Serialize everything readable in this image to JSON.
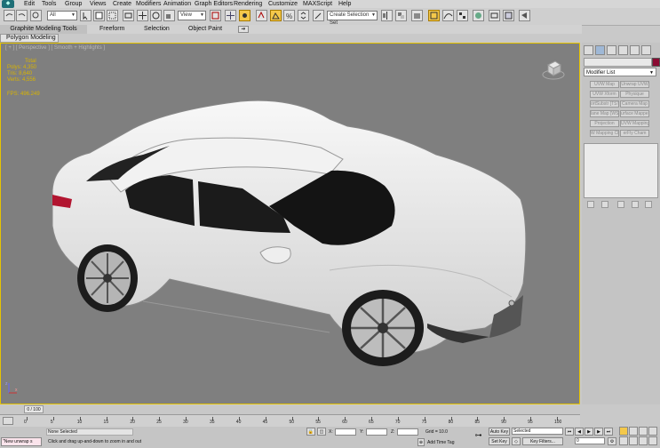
{
  "menubar": {
    "items": [
      "Edit",
      "Tools",
      "Group",
      "Views",
      "Create",
      "Modifiers",
      "Animation",
      "Graph Editors",
      "Rendering",
      "Customize",
      "MAXScript",
      "Help"
    ]
  },
  "toolbar": {
    "selection_filter": "All",
    "ref_coord": "View",
    "named_selection": "Create Selection Set"
  },
  "ribbon": {
    "tabs": [
      "Graphite Modeling Tools",
      "Freeform",
      "Selection",
      "Object Paint"
    ],
    "subtab": "Polygon Modeling"
  },
  "viewport": {
    "label": "[ + ] [ Perspective ] [ Smooth + Highlights ]",
    "stats": {
      "header": "Total",
      "polys": "Polys:  4,350",
      "tris": "Tris:   8,640",
      "verts": "Verts:  4,556",
      "fps": "FPS:    496.249"
    },
    "axis_x": "x",
    "axis_z": "z"
  },
  "command_panel": {
    "modifier_list": "Modifier List",
    "modifier_buttons": [
      "UVW Map",
      "Unwrap UVW",
      "UVW Xform",
      "Physique",
      "ortSubstr [TST]",
      "Camera Map",
      "lane Map [WS]",
      "urface Mapper [W]",
      "Projection",
      "UVW Mapping Ad",
      "W Mapping Cle",
      "erFly Cham"
    ]
  },
  "timeline": {
    "slider_label": "0 / 100",
    "ticks": [
      "0",
      "5",
      "10",
      "15",
      "20",
      "25",
      "30",
      "35",
      "40",
      "45",
      "50",
      "55",
      "60",
      "65",
      "70",
      "75",
      "80",
      "85",
      "90",
      "95",
      "100"
    ]
  },
  "statusbar": {
    "maxscript_text": "\"New unwrap s",
    "selection_status": "None Selected",
    "prompt": "Click and drag up-and-down to zoom in and out",
    "x_label": "X:",
    "y_label": "Y:",
    "z_label": "Z:",
    "grid": "Grid = 10.0",
    "add_time_tag": "Add Time Tag",
    "auto_key": "Auto Key",
    "auto_key_mode": "Selected",
    "set_key": "Set Key",
    "key_filters": "Key Filters...",
    "frame": "0"
  },
  "colors": {
    "viewport_bg": "#7f7f7f",
    "viewport_border": "#e6c400",
    "stats_text": "#d9b400",
    "object_color": "#8b0b33",
    "active_tool": "#f4c84a"
  }
}
